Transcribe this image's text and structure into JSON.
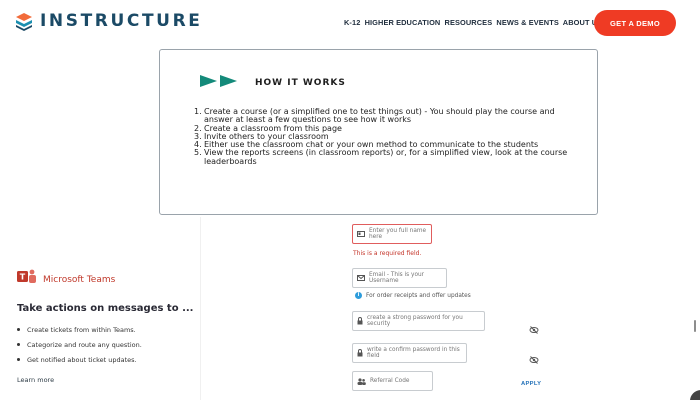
{
  "header": {
    "logo_text": "INSTRUCTURE",
    "nav_items": [
      "K-12",
      "HIGHER EDUCATION",
      "RESOURCES",
      "NEWS & EVENTS",
      "ABOUT US"
    ],
    "cta_label": "GET A DEMO",
    "cta_color": "#ef3b24"
  },
  "how_it_works": {
    "title": "HOW IT WORKS",
    "steps": [
      "Create a course (or a simplified one to test things out) - You should play the course and answer at least a few questions to see how it works",
      "Create a classroom from this page",
      "Invite others to your classroom",
      "Either use the classroom chat or your own method to communicate to the students",
      "View the reports screens (in classroom reports) or, for a simplified view, look at the course leaderboards"
    ]
  },
  "teams": {
    "brand": "Microsoft Teams",
    "heading": "Take actions on messages to ...",
    "bullets": [
      "Create tickets from within Teams.",
      "Categorize and route any question.",
      "Get notified about ticket updates."
    ],
    "link": "Learn more"
  },
  "form": {
    "full_name_placeholder": "Enter you full name here",
    "required_error": "This is a required field.",
    "email_placeholder": "Email - This is your Username",
    "email_info": "For order receipts and offer updates",
    "password_placeholder": "create a strong password for you security",
    "confirm_placeholder": "write a confirm password in this field",
    "referral_placeholder": "Referral Code",
    "apply_label": "APPLY"
  }
}
